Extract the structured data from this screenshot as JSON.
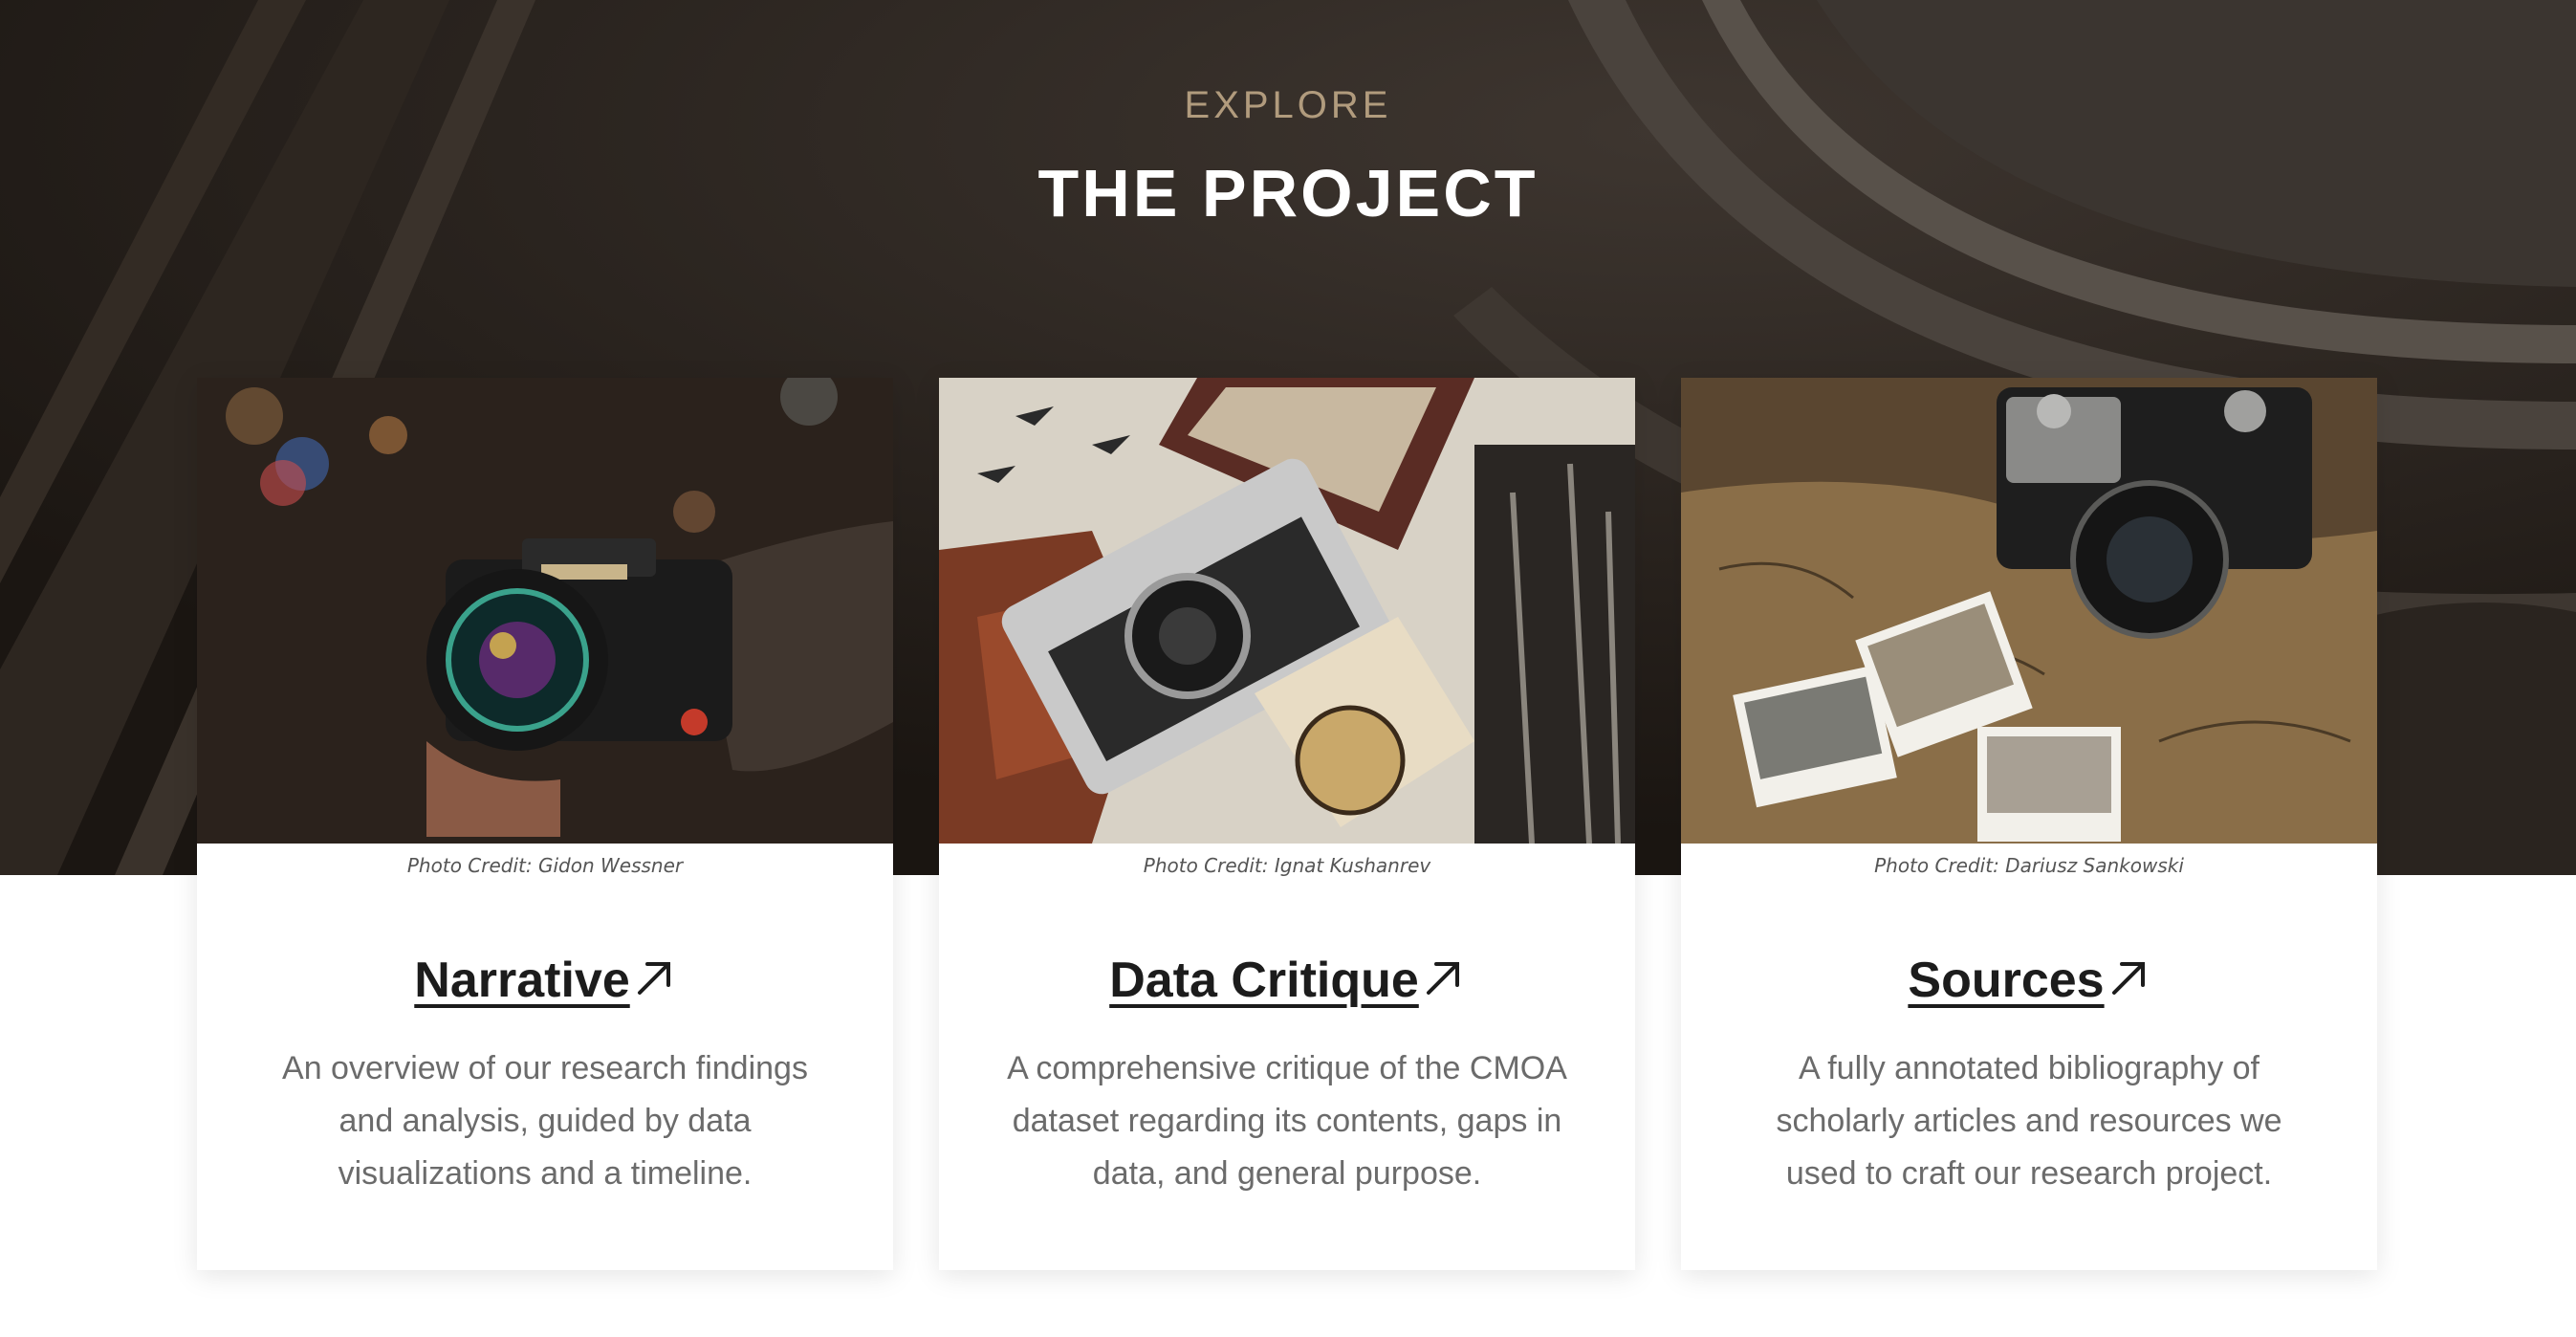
{
  "header": {
    "eyebrow": "EXPLORE",
    "title": "THE PROJECT"
  },
  "cards": [
    {
      "photo_icon": "camera-photo-fujifilm",
      "credit": "Photo Credit: Gidon Wessner",
      "title": "Narrative",
      "description": "An overview of our research findings and analysis, guided by data visualizations and a timeline."
    },
    {
      "photo_icon": "camera-photo-vintage",
      "credit": "Photo Credit: Ignat Kushanrev",
      "title": "Data Critique",
      "description": "A comprehensive critique of the CMOA dataset regarding its contents, gaps in data, and general purpose."
    },
    {
      "photo_icon": "camera-photo-map",
      "credit": "Photo Credit: Dariusz Sankowski",
      "title": "Sources",
      "description": "A fully annotated bibliography of scholarly articles and resources we used to craft our research project."
    }
  ],
  "colors": {
    "hero_bg": "#221c16",
    "eyebrow": "#b19b7d",
    "title": "#ffffff",
    "card_title": "#1c1c1c",
    "card_text": "#6b6b6b"
  }
}
